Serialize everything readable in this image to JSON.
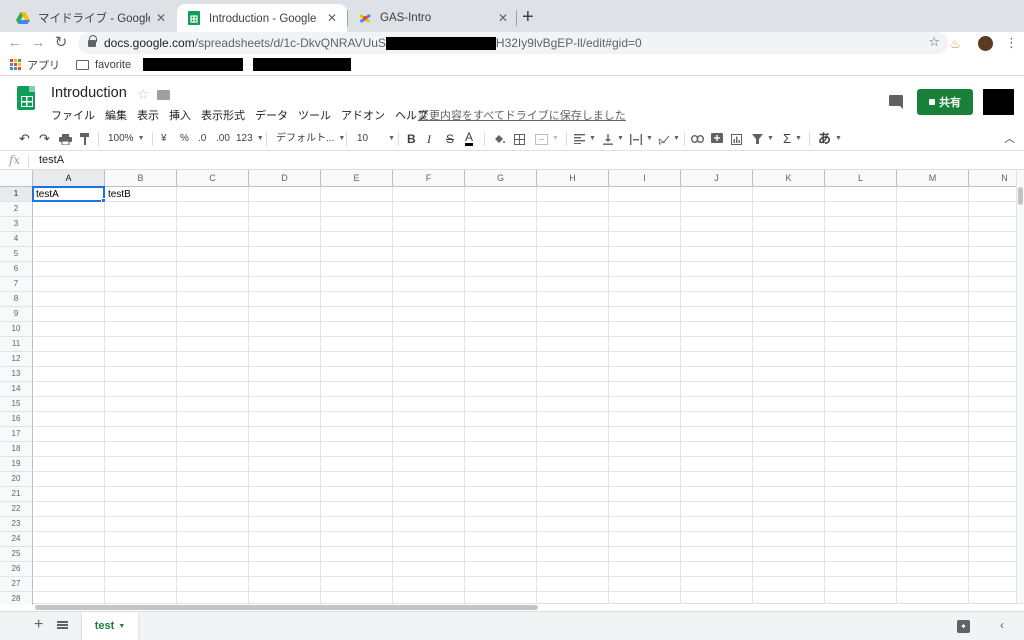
{
  "browser": {
    "tabs": [
      {
        "title": "マイドライブ - Google ドライブ",
        "icon": "google-drive-icon",
        "active": false
      },
      {
        "title": "Introduction - Google スプレッ",
        "icon": "google-sheets-icon",
        "active": true
      },
      {
        "title": "GAS-Intro",
        "icon": "apps-script-icon",
        "active": false
      }
    ],
    "new_tab": "+",
    "url_host": "docs.google.com",
    "url_path_start": "/spreadsheets/d/1c-DkvQNRAVUuS",
    "url_path_end": "H32Iy9lvBgEP-ll/edit#gid=0",
    "bookmarks": {
      "apps": "アプリ",
      "folder": "favorite"
    }
  },
  "doc": {
    "title": "Introduction",
    "menu": [
      "ファイル",
      "編集",
      "表示",
      "挿入",
      "表示形式",
      "データ",
      "ツール",
      "アドオン",
      "ヘルプ"
    ],
    "save_status": "変更内容をすべてドライブに保存しました",
    "share_label": "共有"
  },
  "toolbar": {
    "zoom": "100%",
    "currency": "¥",
    "percent": "%",
    "decrease_decimal": ".0",
    "increase_decimal": ".00",
    "more_formats": "123",
    "font": "デフォルト...",
    "font_size": "10",
    "bold": "B",
    "italic": "I",
    "strike": "S",
    "text_color": "A",
    "input_tools": "あ"
  },
  "formula_bar": {
    "fx": "fx",
    "value": "testA"
  },
  "grid": {
    "columns": [
      "A",
      "B",
      "C",
      "D",
      "E",
      "F",
      "G",
      "H",
      "I",
      "J",
      "K",
      "L",
      "M",
      "N"
    ],
    "rows": [
      "1",
      "2",
      "3",
      "4",
      "5",
      "6",
      "7",
      "8",
      "9",
      "10",
      "11",
      "12",
      "13",
      "14",
      "15",
      "16",
      "17",
      "18",
      "19",
      "20",
      "21",
      "22",
      "23",
      "24",
      "25",
      "26",
      "27",
      "28"
    ],
    "cells": {
      "A1": "testA",
      "B1": "testB"
    },
    "selected_cell": "A1"
  },
  "sheets": {
    "tabs": [
      {
        "name": "test",
        "active": true
      }
    ]
  },
  "colors": {
    "sheets_green": "#0f9d58",
    "share_green": "#188038",
    "selection_blue": "#1a73e8"
  }
}
